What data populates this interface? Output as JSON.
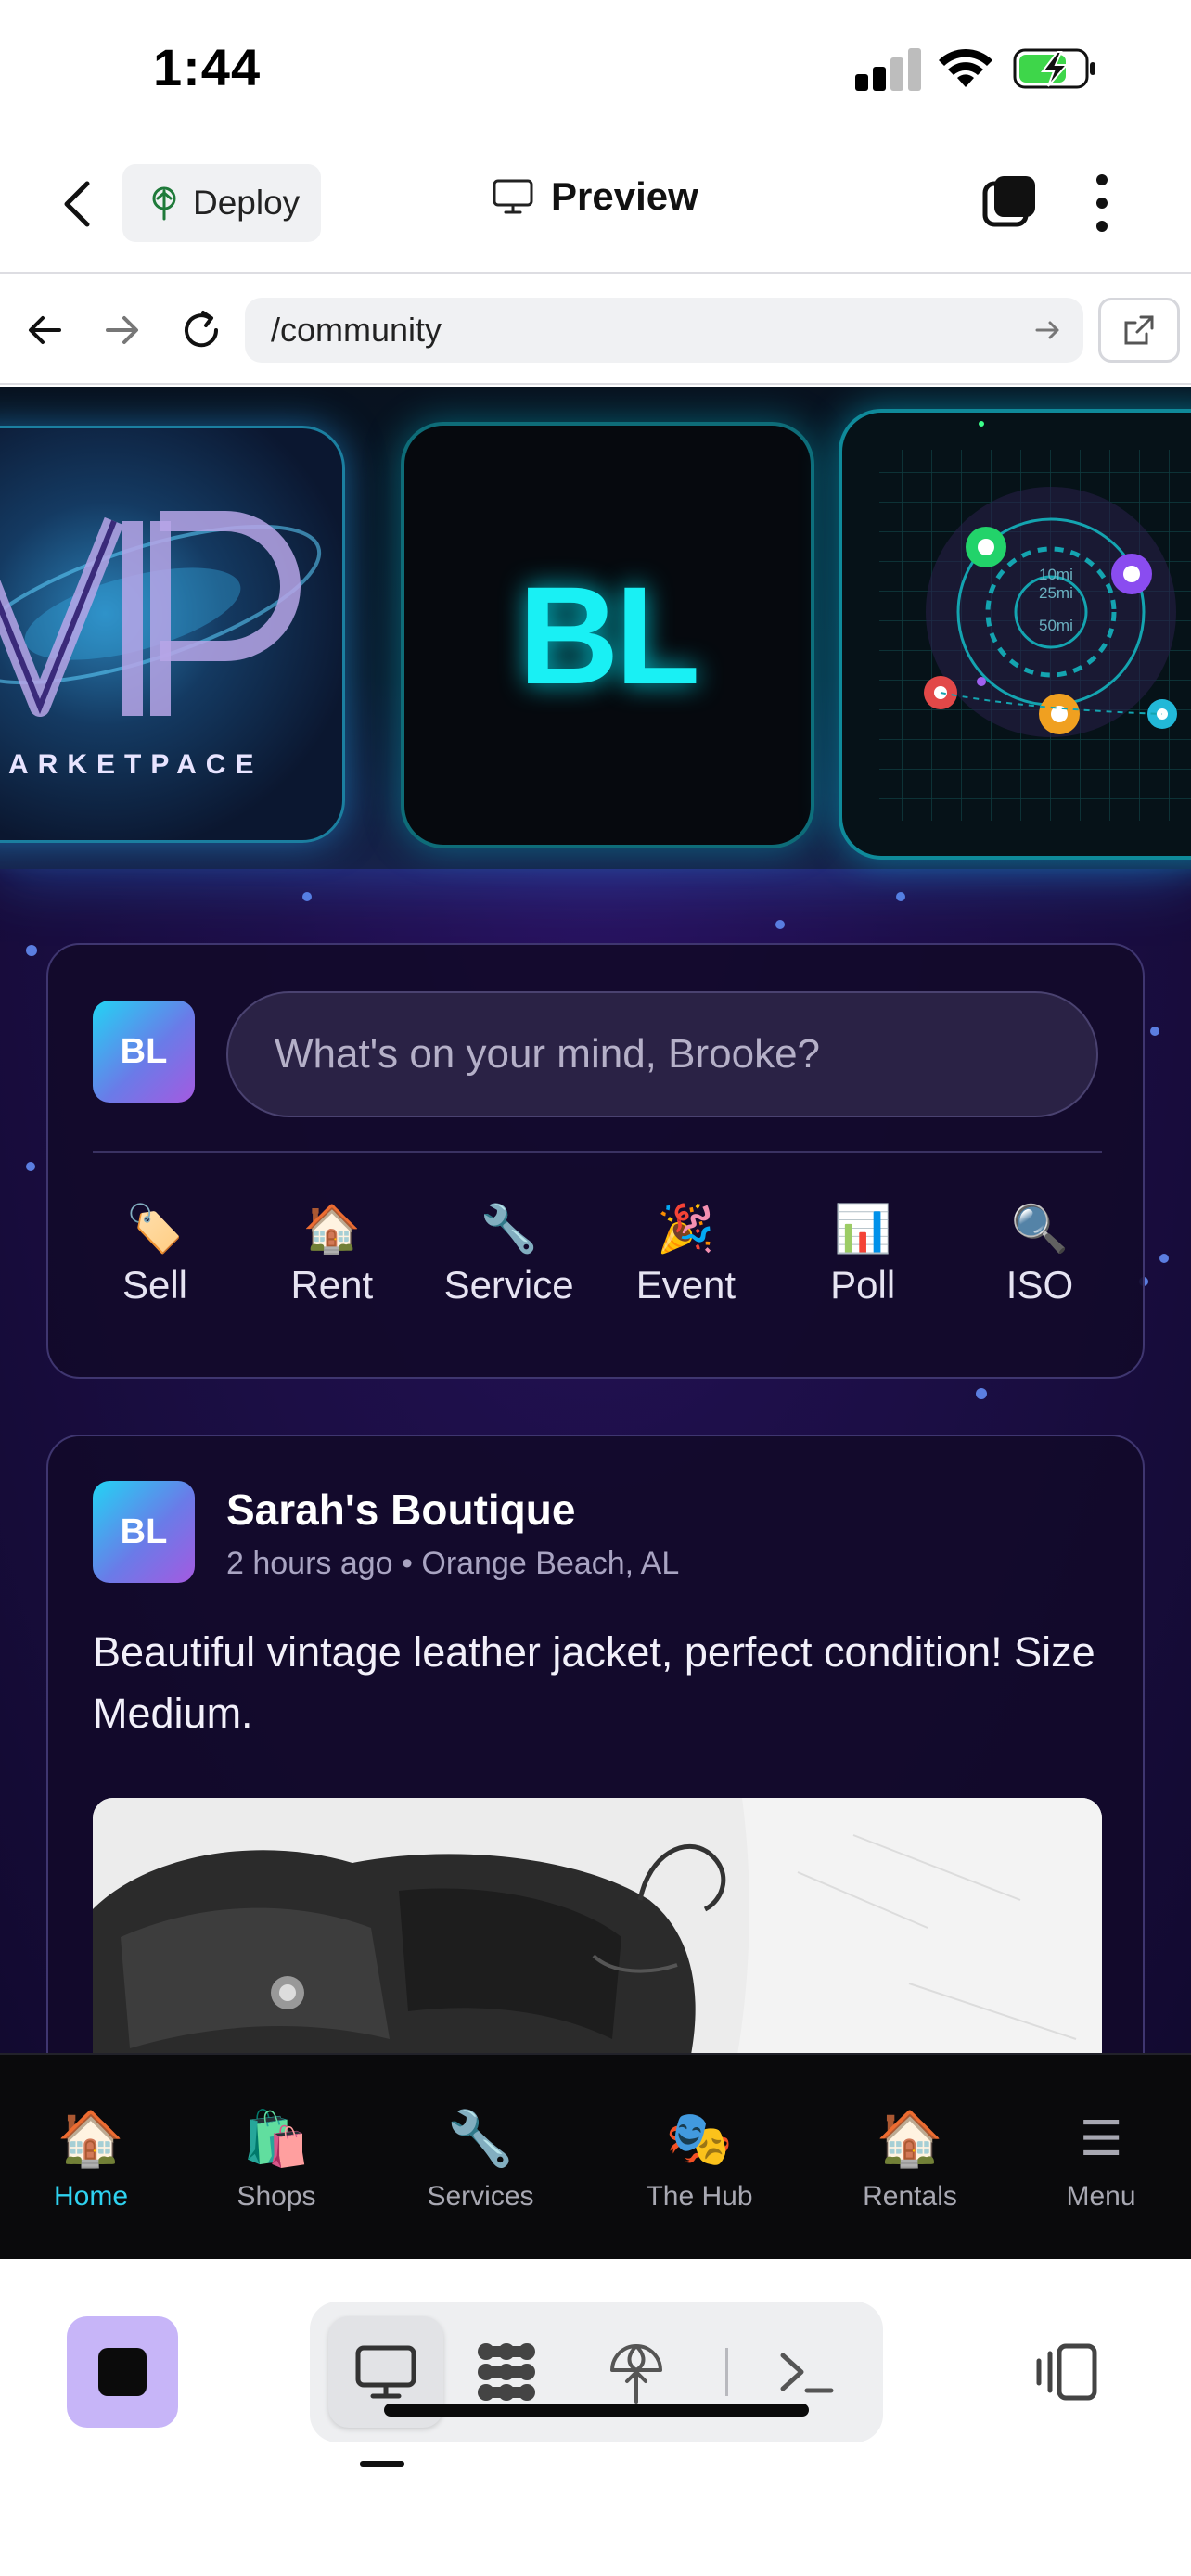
{
  "status_bar": {
    "time": "1:44"
  },
  "app_header": {
    "deploy_label": "Deploy",
    "preview_label": "Preview"
  },
  "browser": {
    "url": "/community"
  },
  "hero": {
    "vip_tile_text": "ARKETPACE",
    "bl_tile_text": "BL",
    "map_rings": [
      "10mi",
      "25mi",
      "50mi"
    ]
  },
  "composer": {
    "avatar_initials": "BL",
    "placeholder": "What's on your mind, Brooke?",
    "actions": [
      {
        "icon": "tag-icon",
        "emoji": "🏷️",
        "label": "Sell"
      },
      {
        "icon": "house-icon",
        "emoji": "🏠",
        "label": "Rent"
      },
      {
        "icon": "wrench-icon",
        "emoji": "🔧",
        "label": "Service"
      },
      {
        "icon": "party-popper-icon",
        "emoji": "🎉",
        "label": "Event"
      },
      {
        "icon": "bar-chart-icon",
        "emoji": "📊",
        "label": "Poll"
      },
      {
        "icon": "magnifier-icon",
        "emoji": "🔍",
        "label": "ISO"
      }
    ]
  },
  "post": {
    "avatar_initials": "BL",
    "author": "Sarah's Boutique",
    "meta": "2 hours ago • Orange Beach, AL",
    "body": "Beautiful vintage leather jacket, perfect condition! Size Medium."
  },
  "tab_bar": {
    "active": "Home",
    "accent_color": "#2fd2f0",
    "tabs": [
      {
        "icon": "house-icon",
        "emoji": "🏠",
        "label": "Home"
      },
      {
        "icon": "shopping-bags-icon",
        "emoji": "🛍️",
        "label": "Shops"
      },
      {
        "icon": "wrench-icon",
        "emoji": "🔧",
        "label": "Services"
      },
      {
        "icon": "theater-masks-icon",
        "emoji": "🎭",
        "label": "The Hub"
      },
      {
        "icon": "house-icon",
        "emoji": "🏠",
        "label": "Rentals"
      },
      {
        "icon": "hamburger-icon",
        "emoji": "☰",
        "label": "Menu"
      }
    ]
  },
  "colors": {
    "brand_cyan": "#19f0f4",
    "stop_button": "#c7b5f8",
    "background_purple": "#1e0f4a"
  }
}
